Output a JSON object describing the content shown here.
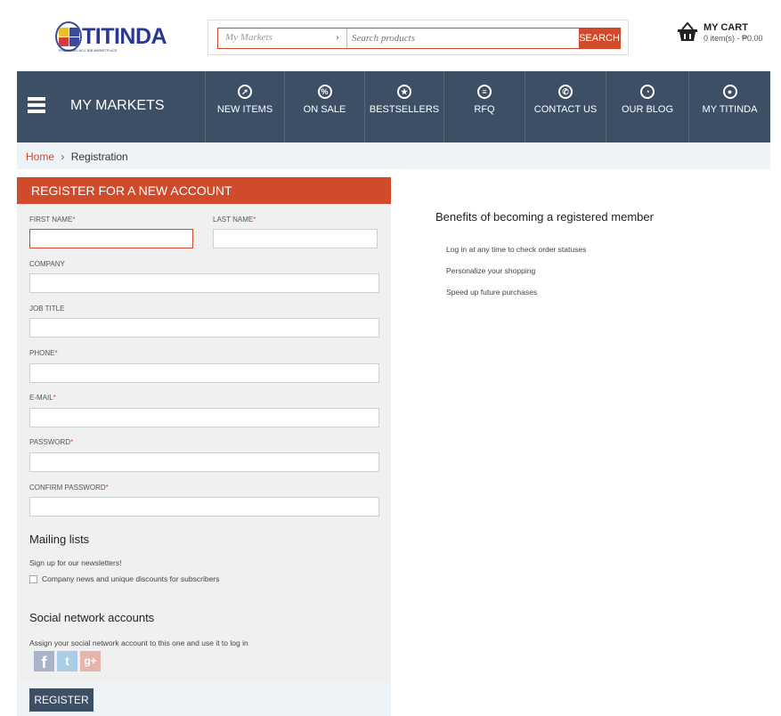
{
  "brand": {
    "name": "TITINDA",
    "tagline": "PHILIPPINES NO.1 B2B MARKETPLACE"
  },
  "search": {
    "market_label": "My Markets",
    "placeholder": "Search products",
    "button_label": "SEARCH"
  },
  "cart": {
    "title": "MY CART",
    "summary": "0 item(s) - ₱0.00"
  },
  "nav": {
    "markets_label": "MY MARKETS",
    "items": [
      {
        "label": "NEW ITEMS",
        "icon": "compass-icon",
        "glyph": "➚"
      },
      {
        "label": "ON SALE",
        "icon": "percent-icon",
        "glyph": "%"
      },
      {
        "label": "BESTSELLERS",
        "icon": "star-icon",
        "glyph": "★"
      },
      {
        "label": "RFQ",
        "icon": "list-icon",
        "glyph": "≡"
      },
      {
        "label": "CONTACT US",
        "icon": "phone-icon",
        "glyph": "✆"
      },
      {
        "label": "OUR BLOG",
        "icon": "rss-icon",
        "glyph": "◔"
      },
      {
        "label": "MY TITINDA",
        "icon": "user-icon",
        "glyph": "●"
      }
    ]
  },
  "breadcrumb": {
    "home": "Home",
    "separator": "›",
    "current": "Registration"
  },
  "form": {
    "heading": "REGISTER FOR A NEW ACCOUNT",
    "required_marker": "*",
    "fields": {
      "first_name": "FIRST NAME",
      "last_name": "LAST NAME",
      "company": "COMPANY",
      "job_title": "JOB TITLE",
      "phone": "PHONE",
      "email": "E-MAIL",
      "password": "PASSWORD",
      "confirm_password": "CONFIRM PASSWORD"
    },
    "mailing_title": "Mailing lists",
    "mailing_intro": "Sign up for our newsletters!",
    "mailing_option": "Company news and unique discounts for subscribers",
    "social_title": "Social network accounts",
    "social_intro": "Assign your social network account to this one and use it to log in",
    "social_buttons": [
      {
        "glyph": "f",
        "icon": "facebook-icon"
      },
      {
        "glyph": "t",
        "icon": "twitter-icon"
      },
      {
        "glyph": "g+",
        "icon": "google-plus-icon"
      }
    ],
    "register_label": "REGISTER"
  },
  "benefits": {
    "title": "Benefits of becoming a registered member",
    "items": [
      "Log in at any time to check order statuses",
      "Personalize your shopping",
      "Speed up future purchases"
    ]
  },
  "colors": {
    "accent": "#d14a2b",
    "nav_bg": "#3d4f64",
    "panel_bg": "#f0f0f0",
    "breadcrumb_bg": "#eef3f8"
  }
}
